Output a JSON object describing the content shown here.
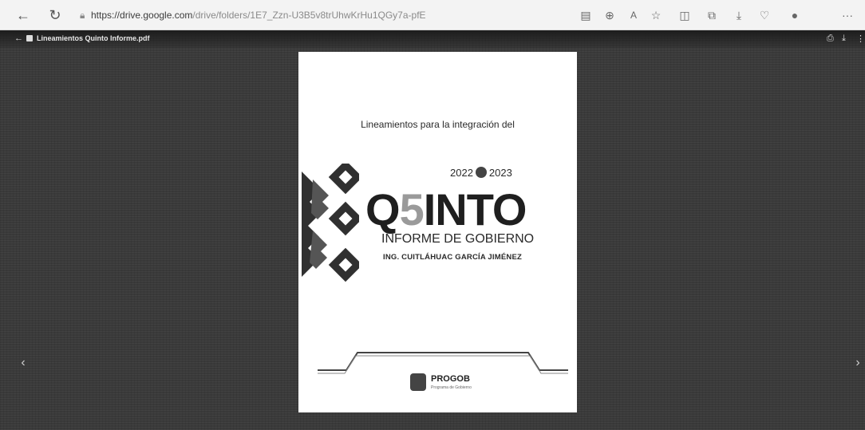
{
  "browser": {
    "back_icon": "arrow-left-icon",
    "reload_icon": "reload-icon",
    "url_host": "https://drive.google.com",
    "url_path": "/drive/folders/1E7_Zzn-U3B5v8trUhwKrHu1QGy7a-pfE",
    "more_label": "···"
  },
  "viewer": {
    "file_name": "Lineamientos Quinto Informe.pdf"
  },
  "document": {
    "lead": "Lineamientos para la integración del",
    "year_start": "2022",
    "year_end": "2023",
    "title_q": "Q",
    "title_five": "5",
    "title_rest": "INTO",
    "subtitle": "INFORME DE GOBIERNO",
    "author": "ING. CUITLÁHUAC GARCÍA JIMÉNEZ",
    "footer_name": "PROGOB",
    "footer_sub": "Programa de Gobierno"
  }
}
